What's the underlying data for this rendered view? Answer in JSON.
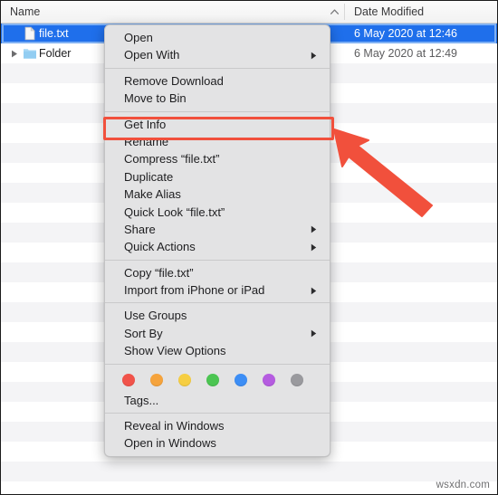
{
  "window": {
    "columns": [
      {
        "label": "Name"
      },
      {
        "label": "Date Modified"
      }
    ],
    "sort_indicator": "chevron-up-icon"
  },
  "files": [
    {
      "name": "file.txt",
      "date": "6 May 2020 at 12:46",
      "icon": "document-icon",
      "selected": true,
      "has_disclosure": false
    },
    {
      "name": "Folder",
      "date": "6 May 2020 at 12:49",
      "icon": "folder-icon",
      "selected": false,
      "has_disclosure": true
    }
  ],
  "context_menu": {
    "groups": [
      {
        "items": [
          {
            "label": "Open",
            "submenu": false
          },
          {
            "label": "Open With",
            "submenu": true
          }
        ]
      },
      {
        "items": [
          {
            "label": "Remove Download",
            "submenu": false
          },
          {
            "label": "Move to Bin",
            "submenu": false
          }
        ]
      },
      {
        "items": [
          {
            "label": "Get Info",
            "submenu": false,
            "highlighted": true
          },
          {
            "label": "Rename",
            "submenu": false
          },
          {
            "label": "Compress “file.txt”",
            "submenu": false
          },
          {
            "label": "Duplicate",
            "submenu": false
          },
          {
            "label": "Make Alias",
            "submenu": false
          },
          {
            "label": "Quick Look “file.txt”",
            "submenu": false
          },
          {
            "label": "Share",
            "submenu": true
          },
          {
            "label": "Quick Actions",
            "submenu": true
          }
        ]
      },
      {
        "items": [
          {
            "label": "Copy “file.txt”",
            "submenu": false
          },
          {
            "label": "Import from iPhone or iPad",
            "submenu": true
          }
        ]
      },
      {
        "items": [
          {
            "label": "Use Groups",
            "submenu": false
          },
          {
            "label": "Sort By",
            "submenu": true
          },
          {
            "label": "Show View Options",
            "submenu": false
          }
        ]
      },
      {
        "tags": {
          "colors": [
            "#f1534a",
            "#f5a33c",
            "#f6ce42",
            "#4cc552",
            "#3d8ef5",
            "#b55ce0",
            "#9a9a9e"
          ],
          "label": "Tags..."
        }
      },
      {
        "items": [
          {
            "label": "Reveal in Windows",
            "submenu": false
          },
          {
            "label": "Open in Windows",
            "submenu": false
          }
        ]
      }
    ]
  },
  "annotations": {
    "highlight_color": "#f1503c",
    "arrow_color": "#f1503c",
    "arrow_target": "Get Info"
  },
  "watermark": {
    "text": "wsxdn.com"
  }
}
